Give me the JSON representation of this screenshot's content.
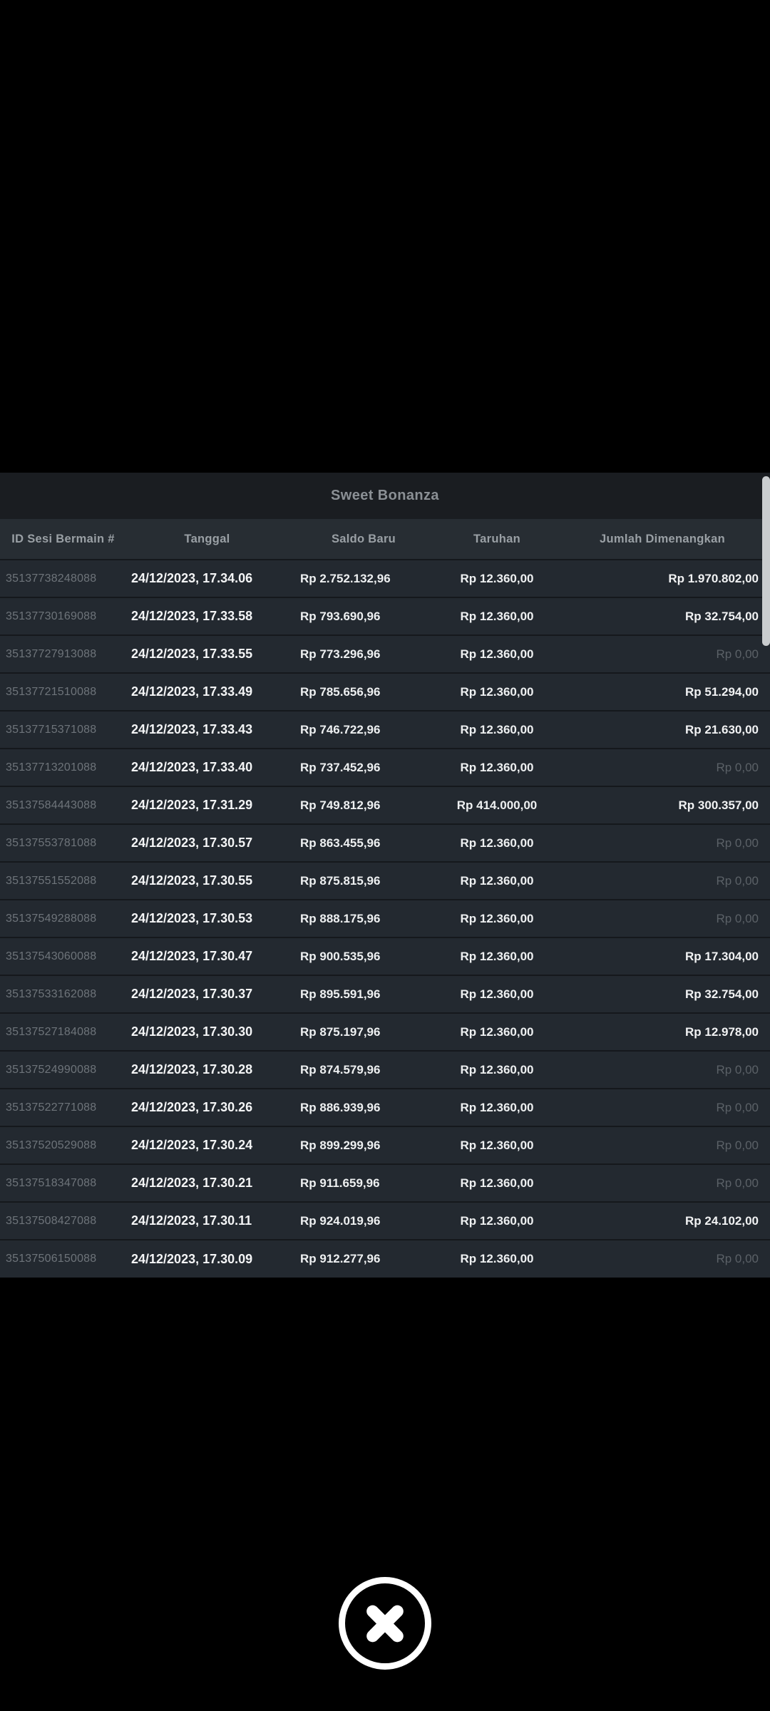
{
  "dialog": {
    "title": "Sweet Bonanza",
    "table": {
      "columns": [
        "ID Sesi Bermain #",
        "Tanggal",
        "Saldo Baru",
        "Taruhan",
        "Jumlah Dimenangkan"
      ],
      "rows": [
        {
          "id": "35137738248088",
          "date": "24/12/2023, 17.34.06",
          "balance": "Rp 2.752.132,96",
          "bet": "Rp 12.360,00",
          "win": "Rp 1.970.802,00",
          "win_zero": false
        },
        {
          "id": "35137730169088",
          "date": "24/12/2023, 17.33.58",
          "balance": "Rp 793.690,96",
          "bet": "Rp 12.360,00",
          "win": "Rp 32.754,00",
          "win_zero": false
        },
        {
          "id": "35137727913088",
          "date": "24/12/2023, 17.33.55",
          "balance": "Rp 773.296,96",
          "bet": "Rp 12.360,00",
          "win": "Rp 0,00",
          "win_zero": true
        },
        {
          "id": "35137721510088",
          "date": "24/12/2023, 17.33.49",
          "balance": "Rp 785.656,96",
          "bet": "Rp 12.360,00",
          "win": "Rp 51.294,00",
          "win_zero": false
        },
        {
          "id": "35137715371088",
          "date": "24/12/2023, 17.33.43",
          "balance": "Rp 746.722,96",
          "bet": "Rp 12.360,00",
          "win": "Rp 21.630,00",
          "win_zero": false
        },
        {
          "id": "35137713201088",
          "date": "24/12/2023, 17.33.40",
          "balance": "Rp 737.452,96",
          "bet": "Rp 12.360,00",
          "win": "Rp 0,00",
          "win_zero": true
        },
        {
          "id": "35137584443088",
          "date": "24/12/2023, 17.31.29",
          "balance": "Rp 749.812,96",
          "bet": "Rp 414.000,00",
          "win": "Rp 300.357,00",
          "win_zero": false
        },
        {
          "id": "35137553781088",
          "date": "24/12/2023, 17.30.57",
          "balance": "Rp 863.455,96",
          "bet": "Rp 12.360,00",
          "win": "Rp 0,00",
          "win_zero": true
        },
        {
          "id": "35137551552088",
          "date": "24/12/2023, 17.30.55",
          "balance": "Rp 875.815,96",
          "bet": "Rp 12.360,00",
          "win": "Rp 0,00",
          "win_zero": true
        },
        {
          "id": "35137549288088",
          "date": "24/12/2023, 17.30.53",
          "balance": "Rp 888.175,96",
          "bet": "Rp 12.360,00",
          "win": "Rp 0,00",
          "win_zero": true
        },
        {
          "id": "35137543060088",
          "date": "24/12/2023, 17.30.47",
          "balance": "Rp 900.535,96",
          "bet": "Rp 12.360,00",
          "win": "Rp 17.304,00",
          "win_zero": false
        },
        {
          "id": "35137533162088",
          "date": "24/12/2023, 17.30.37",
          "balance": "Rp 895.591,96",
          "bet": "Rp 12.360,00",
          "win": "Rp 32.754,00",
          "win_zero": false
        },
        {
          "id": "35137527184088",
          "date": "24/12/2023, 17.30.30",
          "balance": "Rp 875.197,96",
          "bet": "Rp 12.360,00",
          "win": "Rp 12.978,00",
          "win_zero": false
        },
        {
          "id": "35137524990088",
          "date": "24/12/2023, 17.30.28",
          "balance": "Rp 874.579,96",
          "bet": "Rp 12.360,00",
          "win": "Rp 0,00",
          "win_zero": true
        },
        {
          "id": "35137522771088",
          "date": "24/12/2023, 17.30.26",
          "balance": "Rp 886.939,96",
          "bet": "Rp 12.360,00",
          "win": "Rp 0,00",
          "win_zero": true
        },
        {
          "id": "35137520529088",
          "date": "24/12/2023, 17.30.24",
          "balance": "Rp 899.299,96",
          "bet": "Rp 12.360,00",
          "win": "Rp 0,00",
          "win_zero": true
        },
        {
          "id": "35137518347088",
          "date": "24/12/2023, 17.30.21",
          "balance": "Rp 911.659,96",
          "bet": "Rp 12.360,00",
          "win": "Rp 0,00",
          "win_zero": true
        },
        {
          "id": "35137508427088",
          "date": "24/12/2023, 17.30.11",
          "balance": "Rp 924.019,96",
          "bet": "Rp 12.360,00",
          "win": "Rp 24.102,00",
          "win_zero": false
        },
        {
          "id": "35137506150088",
          "date": "24/12/2023, 17.30.09",
          "balance": "Rp 912.277,96",
          "bet": "Rp 12.360,00",
          "win": "Rp 0,00",
          "win_zero": true
        }
      ]
    }
  },
  "close_button": {
    "icon": "x-circle-icon"
  },
  "colors": {
    "page_bg": "#000000",
    "title_bar_bg": "#1a1d21",
    "header_bg": "#272d33",
    "row_bg": "#232930",
    "row_separator": "#15181c",
    "title_text": "#8b9095",
    "header_text": "#9aa0a5",
    "id_text": "#6e747a",
    "value_text": "#f1f2f3",
    "zero_value_text": "#5b6167",
    "scrollbar": "#c9ccce"
  }
}
